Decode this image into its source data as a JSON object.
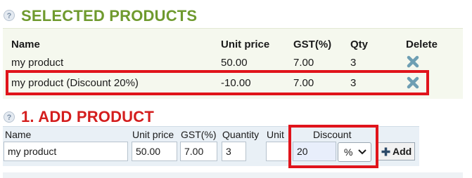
{
  "selected_section": {
    "help_icon": "?",
    "title": "SELECTED PRODUCTS",
    "columns": [
      "Name",
      "Unit price",
      "GST(%)",
      "Qty",
      "Delete"
    ],
    "rows": [
      {
        "name": "my product",
        "unit_price": "50.00",
        "gst": "7.00",
        "qty": "3",
        "delete_icon": "close-x-icon"
      },
      {
        "name": "my product (Discount 20%)",
        "unit_price": "-10.00",
        "gst": "7.00",
        "qty": "3",
        "delete_icon": "close-x-icon"
      }
    ]
  },
  "add_section": {
    "help_icon": "?",
    "title": "1. ADD PRODUCT",
    "labels": {
      "name": "Name",
      "unit_price": "Unit price",
      "gst": "GST(%)",
      "quantity": "Quantity",
      "unit": "Unit",
      "discount": "Discount"
    },
    "values": {
      "name": "my product",
      "unit_price": "50.00",
      "gst": "7.00",
      "quantity": "3",
      "unit": "",
      "discount": "20",
      "discount_type": "%"
    },
    "add_button_label": "Add"
  },
  "colors": {
    "selected_title": "#6f9a2e",
    "add_title": "#d41e1e",
    "highlight_border": "#e0141b",
    "delete_icon": "#6e9fb3"
  }
}
